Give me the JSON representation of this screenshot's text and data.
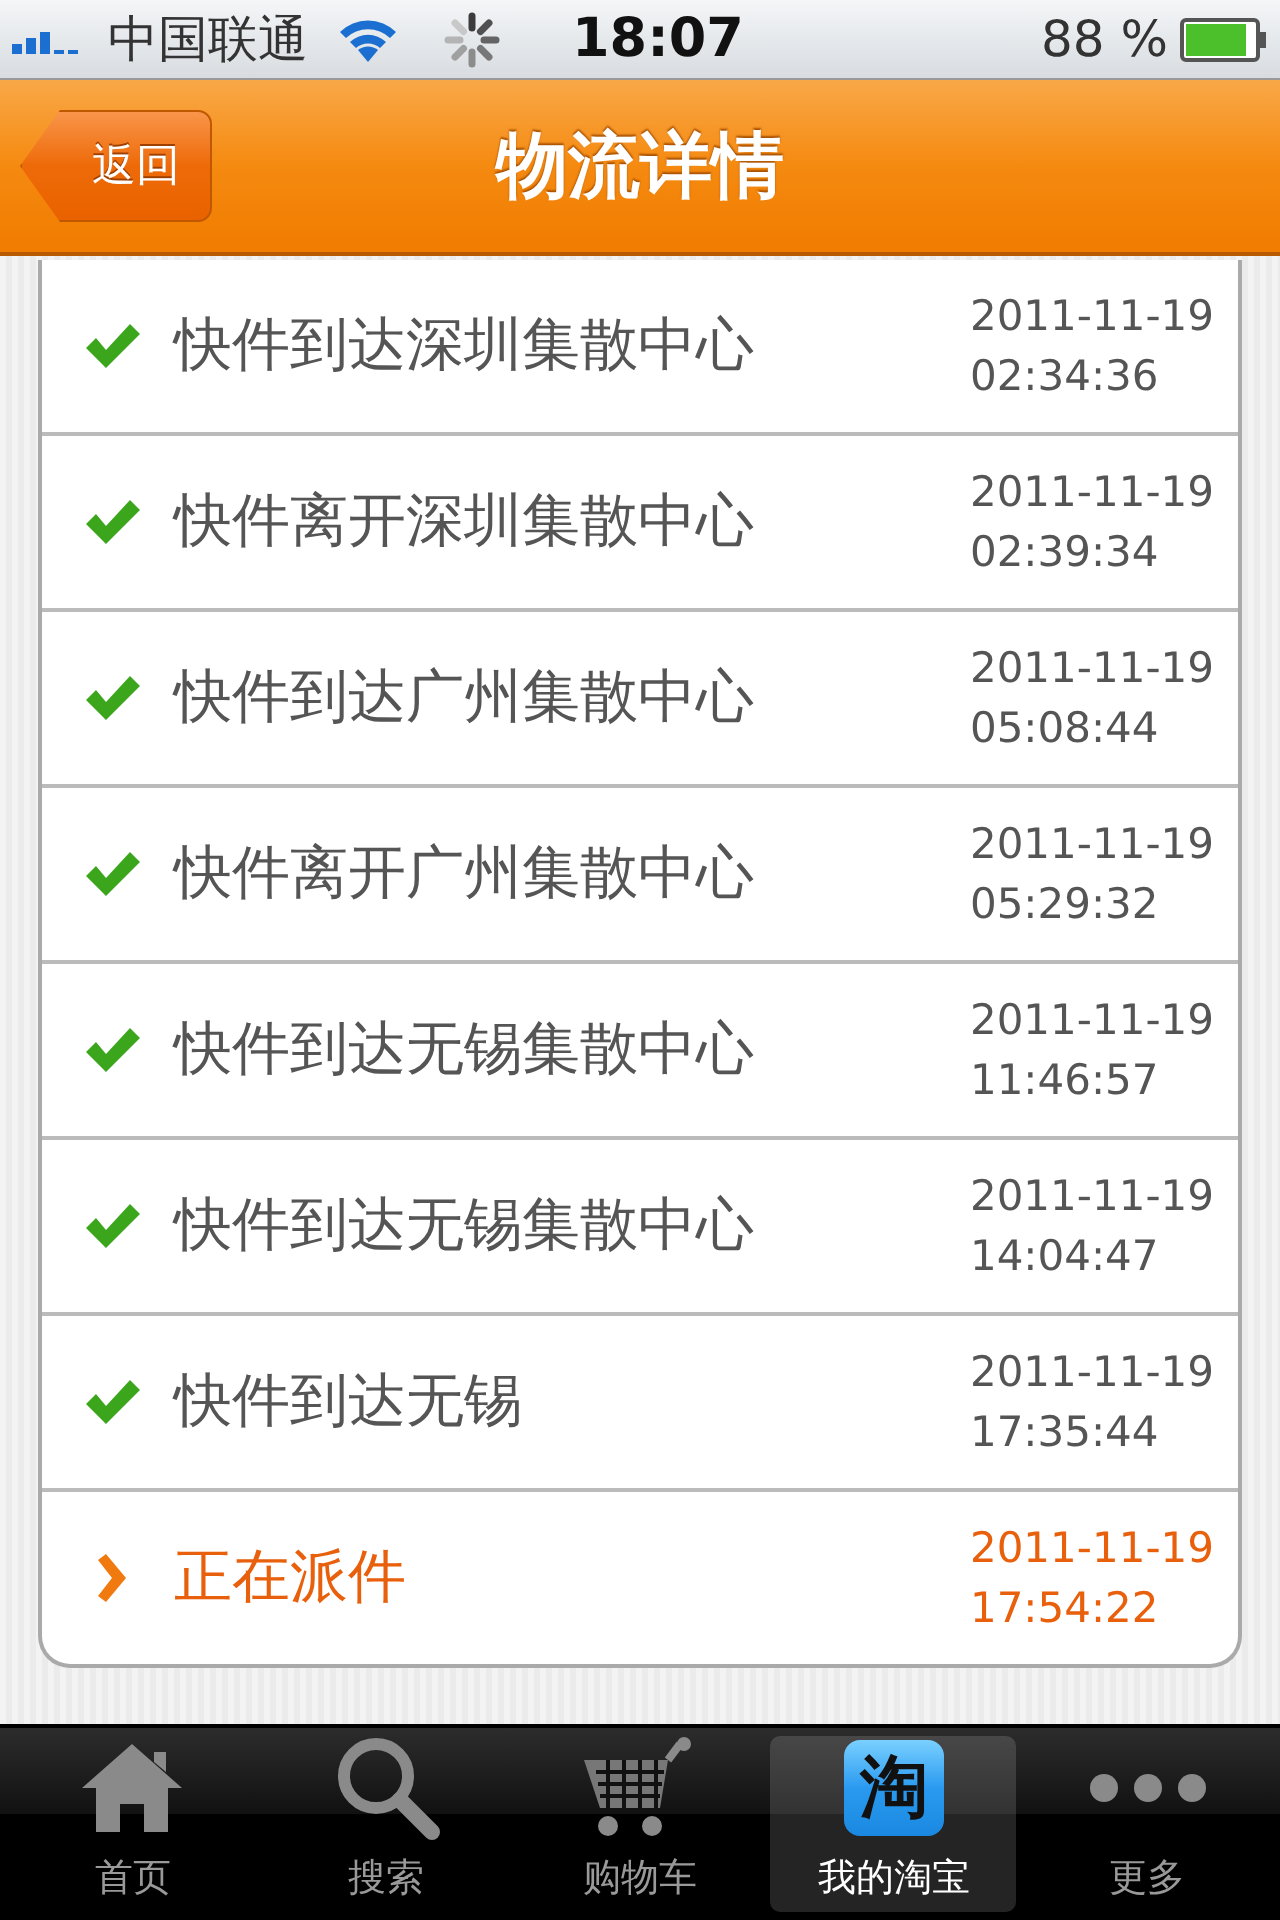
{
  "status_bar": {
    "carrier": "中国联通",
    "time": "18:07",
    "battery": "88 %"
  },
  "nav_bar": {
    "back": "返回",
    "title": "物流详情"
  },
  "tracking": [
    {
      "kind": "done",
      "text": "快件到达深圳集散中心",
      "date": "2011-11-19",
      "time": "02:34:36"
    },
    {
      "kind": "done",
      "text": "快件离开深圳集散中心",
      "date": "2011-11-19",
      "time": "02:39:34"
    },
    {
      "kind": "done",
      "text": "快件到达广州集散中心",
      "date": "2011-11-19",
      "time": "05:08:44"
    },
    {
      "kind": "done",
      "text": "快件离开广州集散中心",
      "date": "2011-11-19",
      "time": "05:29:32"
    },
    {
      "kind": "done",
      "text": "快件到达无锡集散中心",
      "date": "2011-11-19",
      "time": "11:46:57"
    },
    {
      "kind": "done",
      "text": "快件到达无锡集散中心",
      "date": "2011-11-19",
      "time": "14:04:47"
    },
    {
      "kind": "done",
      "text": "快件到达无锡",
      "date": "2011-11-19",
      "time": "17:35:44"
    },
    {
      "kind": "current",
      "text": "正在派件",
      "date": "2011-11-19",
      "time": "17:54:22"
    }
  ],
  "tab_bar": [
    {
      "kind": "home",
      "label": "首页",
      "selected": false
    },
    {
      "kind": "search",
      "label": "搜索",
      "selected": false
    },
    {
      "kind": "cart",
      "label": "购物车",
      "selected": false
    },
    {
      "kind": "taobao",
      "icon_text": "淘",
      "label": "我的淘宝",
      "selected": true
    },
    {
      "kind": "more",
      "label": "更多",
      "selected": false
    }
  ]
}
